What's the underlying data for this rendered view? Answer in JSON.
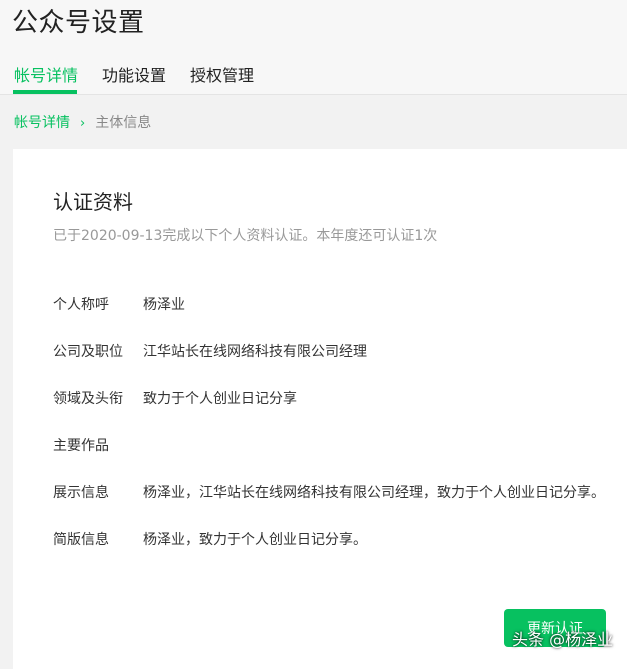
{
  "header": {
    "title": "公众号设置"
  },
  "tabs": [
    {
      "label": "帐号详情"
    },
    {
      "label": "功能设置"
    },
    {
      "label": "授权管理"
    }
  ],
  "breadcrumb": {
    "parent": "帐号详情",
    "separator": "›",
    "current": "主体信息"
  },
  "card": {
    "title": "认证资料",
    "description": "已于2020-09-13完成以下个人资料认证。本年度还可认证1次",
    "rows": [
      {
        "label": "个人称呼",
        "value": "杨泽业"
      },
      {
        "label": "公司及职位",
        "value": "江华站长在线网络科技有限公司经理"
      },
      {
        "label": "领域及头衔",
        "value": "致力于个人创业日记分享"
      },
      {
        "label": "主要作品",
        "value": ""
      },
      {
        "label": "展示信息",
        "value": "杨泽业，江华站长在线网络科技有限公司经理，致力于个人创业日记分享。"
      },
      {
        "label": "简版信息",
        "value": "杨泽业，致力于个人创业日记分享。"
      }
    ],
    "button": "更新认证"
  },
  "watermark": "头条 @杨泽业",
  "colors": {
    "accent": "#07c160",
    "muted": "#999999",
    "background": "#f2f2f2"
  }
}
